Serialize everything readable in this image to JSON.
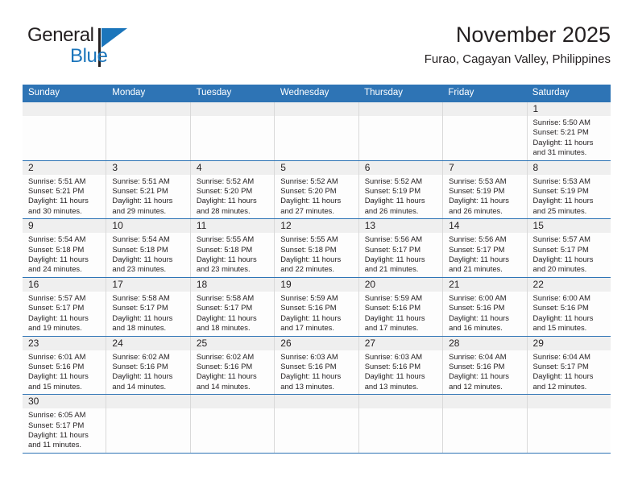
{
  "brand": {
    "name_part1": "General",
    "name_part2": "Blue",
    "logo_icon": "triangle-flag-icon"
  },
  "header": {
    "title": "November 2025",
    "subtitle": "Furao, Cagayan Valley, Philippines"
  },
  "colors": {
    "header_blue": "#2e74b5",
    "brand_blue": "#1b75bb",
    "day_band_gray": "#efefef",
    "cell_border": "#d9d9d9",
    "text": "#231f20"
  },
  "weekdays": [
    "Sunday",
    "Monday",
    "Tuesday",
    "Wednesday",
    "Thursday",
    "Friday",
    "Saturday"
  ],
  "weeks": [
    [
      {
        "empty": true,
        "day": "",
        "sunrise": "",
        "sunset": "",
        "daylight_line1": "",
        "daylight_line2": ""
      },
      {
        "empty": true,
        "day": "",
        "sunrise": "",
        "sunset": "",
        "daylight_line1": "",
        "daylight_line2": ""
      },
      {
        "empty": true,
        "day": "",
        "sunrise": "",
        "sunset": "",
        "daylight_line1": "",
        "daylight_line2": ""
      },
      {
        "empty": true,
        "day": "",
        "sunrise": "",
        "sunset": "",
        "daylight_line1": "",
        "daylight_line2": ""
      },
      {
        "empty": true,
        "day": "",
        "sunrise": "",
        "sunset": "",
        "daylight_line1": "",
        "daylight_line2": ""
      },
      {
        "empty": true,
        "day": "",
        "sunrise": "",
        "sunset": "",
        "daylight_line1": "",
        "daylight_line2": ""
      },
      {
        "empty": false,
        "day": "1",
        "sunrise": "Sunrise: 5:50 AM",
        "sunset": "Sunset: 5:21 PM",
        "daylight_line1": "Daylight: 11 hours",
        "daylight_line2": "and 31 minutes."
      }
    ],
    [
      {
        "empty": false,
        "day": "2",
        "sunrise": "Sunrise: 5:51 AM",
        "sunset": "Sunset: 5:21 PM",
        "daylight_line1": "Daylight: 11 hours",
        "daylight_line2": "and 30 minutes."
      },
      {
        "empty": false,
        "day": "3",
        "sunrise": "Sunrise: 5:51 AM",
        "sunset": "Sunset: 5:21 PM",
        "daylight_line1": "Daylight: 11 hours",
        "daylight_line2": "and 29 minutes."
      },
      {
        "empty": false,
        "day": "4",
        "sunrise": "Sunrise: 5:52 AM",
        "sunset": "Sunset: 5:20 PM",
        "daylight_line1": "Daylight: 11 hours",
        "daylight_line2": "and 28 minutes."
      },
      {
        "empty": false,
        "day": "5",
        "sunrise": "Sunrise: 5:52 AM",
        "sunset": "Sunset: 5:20 PM",
        "daylight_line1": "Daylight: 11 hours",
        "daylight_line2": "and 27 minutes."
      },
      {
        "empty": false,
        "day": "6",
        "sunrise": "Sunrise: 5:52 AM",
        "sunset": "Sunset: 5:19 PM",
        "daylight_line1": "Daylight: 11 hours",
        "daylight_line2": "and 26 minutes."
      },
      {
        "empty": false,
        "day": "7",
        "sunrise": "Sunrise: 5:53 AM",
        "sunset": "Sunset: 5:19 PM",
        "daylight_line1": "Daylight: 11 hours",
        "daylight_line2": "and 26 minutes."
      },
      {
        "empty": false,
        "day": "8",
        "sunrise": "Sunrise: 5:53 AM",
        "sunset": "Sunset: 5:19 PM",
        "daylight_line1": "Daylight: 11 hours",
        "daylight_line2": "and 25 minutes."
      }
    ],
    [
      {
        "empty": false,
        "day": "9",
        "sunrise": "Sunrise: 5:54 AM",
        "sunset": "Sunset: 5:18 PM",
        "daylight_line1": "Daylight: 11 hours",
        "daylight_line2": "and 24 minutes."
      },
      {
        "empty": false,
        "day": "10",
        "sunrise": "Sunrise: 5:54 AM",
        "sunset": "Sunset: 5:18 PM",
        "daylight_line1": "Daylight: 11 hours",
        "daylight_line2": "and 23 minutes."
      },
      {
        "empty": false,
        "day": "11",
        "sunrise": "Sunrise: 5:55 AM",
        "sunset": "Sunset: 5:18 PM",
        "daylight_line1": "Daylight: 11 hours",
        "daylight_line2": "and 23 minutes."
      },
      {
        "empty": false,
        "day": "12",
        "sunrise": "Sunrise: 5:55 AM",
        "sunset": "Sunset: 5:18 PM",
        "daylight_line1": "Daylight: 11 hours",
        "daylight_line2": "and 22 minutes."
      },
      {
        "empty": false,
        "day": "13",
        "sunrise": "Sunrise: 5:56 AM",
        "sunset": "Sunset: 5:17 PM",
        "daylight_line1": "Daylight: 11 hours",
        "daylight_line2": "and 21 minutes."
      },
      {
        "empty": false,
        "day": "14",
        "sunrise": "Sunrise: 5:56 AM",
        "sunset": "Sunset: 5:17 PM",
        "daylight_line1": "Daylight: 11 hours",
        "daylight_line2": "and 21 minutes."
      },
      {
        "empty": false,
        "day": "15",
        "sunrise": "Sunrise: 5:57 AM",
        "sunset": "Sunset: 5:17 PM",
        "daylight_line1": "Daylight: 11 hours",
        "daylight_line2": "and 20 minutes."
      }
    ],
    [
      {
        "empty": false,
        "day": "16",
        "sunrise": "Sunrise: 5:57 AM",
        "sunset": "Sunset: 5:17 PM",
        "daylight_line1": "Daylight: 11 hours",
        "daylight_line2": "and 19 minutes."
      },
      {
        "empty": false,
        "day": "17",
        "sunrise": "Sunrise: 5:58 AM",
        "sunset": "Sunset: 5:17 PM",
        "daylight_line1": "Daylight: 11 hours",
        "daylight_line2": "and 18 minutes."
      },
      {
        "empty": false,
        "day": "18",
        "sunrise": "Sunrise: 5:58 AM",
        "sunset": "Sunset: 5:17 PM",
        "daylight_line1": "Daylight: 11 hours",
        "daylight_line2": "and 18 minutes."
      },
      {
        "empty": false,
        "day": "19",
        "sunrise": "Sunrise: 5:59 AM",
        "sunset": "Sunset: 5:16 PM",
        "daylight_line1": "Daylight: 11 hours",
        "daylight_line2": "and 17 minutes."
      },
      {
        "empty": false,
        "day": "20",
        "sunrise": "Sunrise: 5:59 AM",
        "sunset": "Sunset: 5:16 PM",
        "daylight_line1": "Daylight: 11 hours",
        "daylight_line2": "and 17 minutes."
      },
      {
        "empty": false,
        "day": "21",
        "sunrise": "Sunrise: 6:00 AM",
        "sunset": "Sunset: 5:16 PM",
        "daylight_line1": "Daylight: 11 hours",
        "daylight_line2": "and 16 minutes."
      },
      {
        "empty": false,
        "day": "22",
        "sunrise": "Sunrise: 6:00 AM",
        "sunset": "Sunset: 5:16 PM",
        "daylight_line1": "Daylight: 11 hours",
        "daylight_line2": "and 15 minutes."
      }
    ],
    [
      {
        "empty": false,
        "day": "23",
        "sunrise": "Sunrise: 6:01 AM",
        "sunset": "Sunset: 5:16 PM",
        "daylight_line1": "Daylight: 11 hours",
        "daylight_line2": "and 15 minutes."
      },
      {
        "empty": false,
        "day": "24",
        "sunrise": "Sunrise: 6:02 AM",
        "sunset": "Sunset: 5:16 PM",
        "daylight_line1": "Daylight: 11 hours",
        "daylight_line2": "and 14 minutes."
      },
      {
        "empty": false,
        "day": "25",
        "sunrise": "Sunrise: 6:02 AM",
        "sunset": "Sunset: 5:16 PM",
        "daylight_line1": "Daylight: 11 hours",
        "daylight_line2": "and 14 minutes."
      },
      {
        "empty": false,
        "day": "26",
        "sunrise": "Sunrise: 6:03 AM",
        "sunset": "Sunset: 5:16 PM",
        "daylight_line1": "Daylight: 11 hours",
        "daylight_line2": "and 13 minutes."
      },
      {
        "empty": false,
        "day": "27",
        "sunrise": "Sunrise: 6:03 AM",
        "sunset": "Sunset: 5:16 PM",
        "daylight_line1": "Daylight: 11 hours",
        "daylight_line2": "and 13 minutes."
      },
      {
        "empty": false,
        "day": "28",
        "sunrise": "Sunrise: 6:04 AM",
        "sunset": "Sunset: 5:16 PM",
        "daylight_line1": "Daylight: 11 hours",
        "daylight_line2": "and 12 minutes."
      },
      {
        "empty": false,
        "day": "29",
        "sunrise": "Sunrise: 6:04 AM",
        "sunset": "Sunset: 5:17 PM",
        "daylight_line1": "Daylight: 11 hours",
        "daylight_line2": "and 12 minutes."
      }
    ],
    [
      {
        "empty": false,
        "day": "30",
        "sunrise": "Sunrise: 6:05 AM",
        "sunset": "Sunset: 5:17 PM",
        "daylight_line1": "Daylight: 11 hours",
        "daylight_line2": "and 11 minutes."
      },
      {
        "empty": true,
        "day": "",
        "sunrise": "",
        "sunset": "",
        "daylight_line1": "",
        "daylight_line2": ""
      },
      {
        "empty": true,
        "day": "",
        "sunrise": "",
        "sunset": "",
        "daylight_line1": "",
        "daylight_line2": ""
      },
      {
        "empty": true,
        "day": "",
        "sunrise": "",
        "sunset": "",
        "daylight_line1": "",
        "daylight_line2": ""
      },
      {
        "empty": true,
        "day": "",
        "sunrise": "",
        "sunset": "",
        "daylight_line1": "",
        "daylight_line2": ""
      },
      {
        "empty": true,
        "day": "",
        "sunrise": "",
        "sunset": "",
        "daylight_line1": "",
        "daylight_line2": ""
      },
      {
        "empty": true,
        "day": "",
        "sunrise": "",
        "sunset": "",
        "daylight_line1": "",
        "daylight_line2": ""
      }
    ]
  ]
}
